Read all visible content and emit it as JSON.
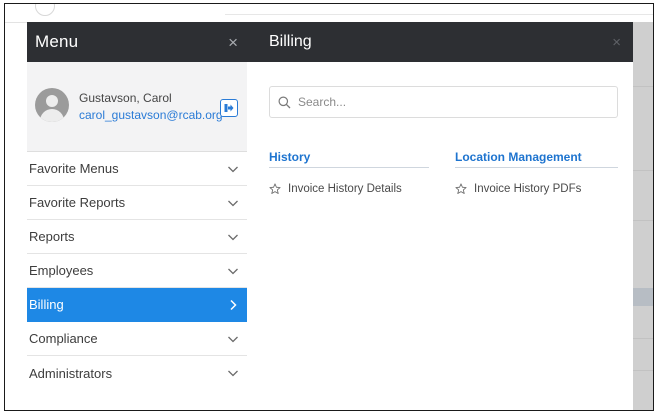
{
  "sidebar": {
    "title": "Menu",
    "close_glyph": "×",
    "user": {
      "name": "Gustavson, Carol",
      "email": "carol_gustavson@rcab.org"
    },
    "items": [
      {
        "label": "Favorite Menus",
        "active": false
      },
      {
        "label": "Favorite Reports",
        "active": false
      },
      {
        "label": "Reports",
        "active": false
      },
      {
        "label": "Employees",
        "active": false
      },
      {
        "label": "Billing",
        "active": true
      },
      {
        "label": "Compliance",
        "active": false
      },
      {
        "label": "Administrators",
        "active": false
      }
    ]
  },
  "panel": {
    "title": "Billing",
    "close_glyph": "×",
    "search": {
      "placeholder": "Search...",
      "value": ""
    },
    "sections": [
      {
        "heading": "History",
        "links": [
          "Invoice History Details"
        ]
      },
      {
        "heading": "Location Management",
        "links": [
          "Invoice History PDFs"
        ]
      }
    ]
  },
  "colors": {
    "header_bg": "#2d2f33",
    "accent": "#1e88e5",
    "link": "#2a7bd6"
  },
  "icons": {
    "user": "avatar-placeholder-icon",
    "logout": "sign-out-arrow-icon",
    "search": "magnifier-icon",
    "favorite": "star-outline-icon",
    "expand": "chevron-down-icon",
    "open": "chevron-right-icon"
  }
}
